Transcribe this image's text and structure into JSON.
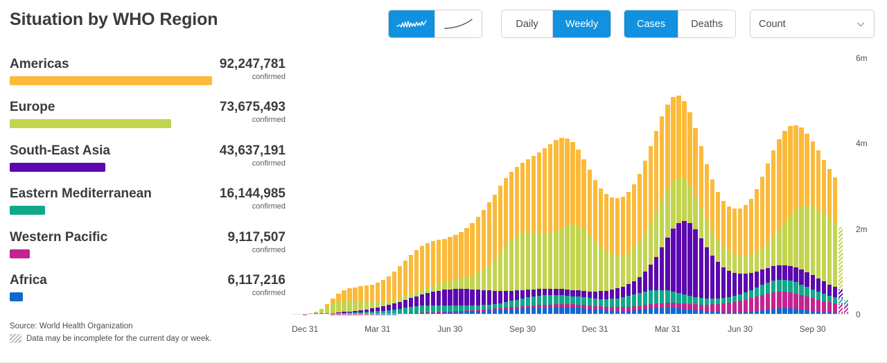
{
  "header": {
    "title": "Situation by WHO Region",
    "chart_type_toggle": {
      "options": [
        {
          "id": "daily-bars",
          "icon": "wavy-line-icon",
          "selected": true
        },
        {
          "id": "cumulative",
          "icon": "rising-curve-icon",
          "selected": false
        }
      ]
    },
    "interval_toggle": {
      "options": [
        {
          "label": "Daily",
          "selected": false
        },
        {
          "label": "Weekly",
          "selected": true
        }
      ]
    },
    "metric_toggle": {
      "options": [
        {
          "label": "Cases",
          "selected": true
        },
        {
          "label": "Deaths",
          "selected": false
        }
      ]
    },
    "measure_dropdown": {
      "value": "Count",
      "icon": "chevron-down-icon"
    }
  },
  "legend": {
    "confirmed_label": "confirmed",
    "regions": [
      {
        "name": "Americas",
        "count": "92,247,781",
        "value": 92247781,
        "color": "#FCBA3A",
        "bar_width_pct": 100.0
      },
      {
        "name": "Europe",
        "count": "73,675,493",
        "value": 73675493,
        "color": "#C3D44F",
        "bar_width_pct": 79.9
      },
      {
        "name": "South-East Asia",
        "count": "43,637,191",
        "value": 43637191,
        "color": "#5B08B0",
        "bar_width_pct": 47.3
      },
      {
        "name": "Eastern Mediterranean",
        "count": "16,144,985",
        "value": 16144985,
        "color": "#0FA98A",
        "bar_width_pct": 17.5
      },
      {
        "name": "Western Pacific",
        "count": "9,117,507",
        "value": 9117507,
        "color": "#C4248F",
        "bar_width_pct": 9.9
      },
      {
        "name": "Africa",
        "count": "6,117,216",
        "value": 6117216,
        "color": "#1069D0",
        "bar_width_pct": 6.6
      }
    ]
  },
  "footer": {
    "source": "Source:  World Health Organization",
    "note": "Data may be incomplete for the current day or week.",
    "note_icon": "hatched-swatch-icon"
  },
  "chart_data": {
    "type": "bar",
    "stacked": true,
    "title": "Situation by WHO Region",
    "xlabel": "",
    "ylabel": "",
    "ylim": [
      0,
      6000000
    ],
    "yticks": [
      0,
      2000000,
      4000000,
      6000000
    ],
    "ytick_labels": [
      "0",
      "2m",
      "4m",
      "6m"
    ],
    "grid": false,
    "legend_position": "left-panel",
    "xtick_labels": [
      "Dec 31",
      "Mar 31",
      "Jun 30",
      "Sep 30",
      "Dec 31",
      "Mar 31",
      "Jun 30",
      "Sep 30"
    ],
    "xtick_indices": [
      2,
      15,
      28,
      41,
      54,
      67,
      80,
      93
    ],
    "series": [
      {
        "name": "Africa",
        "color": "#1069D0",
        "values": [
          0,
          0,
          0,
          0,
          0,
          0,
          0,
          0,
          0,
          0,
          0,
          0,
          200,
          500,
          900,
          1500,
          2500,
          4000,
          6500,
          9000,
          12000,
          16000,
          21000,
          26000,
          30000,
          34000,
          38000,
          42000,
          47000,
          52000,
          58000,
          64000,
          70000,
          76000,
          84000,
          92000,
          100000,
          108000,
          116000,
          124000,
          132000,
          140000,
          148000,
          156000,
          162000,
          168000,
          172000,
          176000,
          178000,
          176000,
          170000,
          160000,
          148000,
          136000,
          124000,
          112000,
          100000,
          92000,
          86000,
          84000,
          88000,
          96000,
          108000,
          124000,
          140000,
          152000,
          160000,
          164000,
          160000,
          150000,
          136000,
          120000,
          104000,
          90000,
          78000,
          68000,
          60000,
          54000,
          50000,
          48000,
          48000,
          52000,
          60000,
          74000,
          92000,
          112000,
          130000,
          142000,
          146000,
          142000,
          130000,
          114000,
          96000,
          80000,
          66000,
          56000,
          48000,
          42000,
          38000,
          34000
        ]
      },
      {
        "name": "Western Pacific",
        "color": "#C4248F",
        "values": [
          200,
          600,
          3000,
          12000,
          22000,
          18000,
          12000,
          8000,
          6000,
          5000,
          4500,
          4500,
          5000,
          5500,
          6000,
          6500,
          7000,
          7500,
          8000,
          9000,
          10000,
          12000,
          14000,
          16000,
          18000,
          20000,
          22000,
          24000,
          26000,
          28000,
          30000,
          32000,
          34000,
          36000,
          38000,
          40000,
          42000,
          44000,
          46000,
          48000,
          50000,
          52000,
          54000,
          56000,
          58000,
          60000,
          62000,
          64000,
          66000,
          68000,
          70000,
          72000,
          74000,
          76000,
          78000,
          80000,
          82000,
          84000,
          86000,
          88000,
          90000,
          92000,
          94000,
          96000,
          98000,
          100000,
          104000,
          108000,
          112000,
          116000,
          120000,
          126000,
          134000,
          144000,
          156000,
          170000,
          186000,
          204000,
          224000,
          246000,
          270000,
          296000,
          322000,
          346000,
          366000,
          380000,
          388000,
          390000,
          386000,
          376000,
          362000,
          344000,
          324000,
          302000,
          280000,
          258000,
          238000,
          220000,
          204000,
          190000
        ]
      },
      {
        "name": "Eastern Mediterranean",
        "color": "#0FA98A",
        "values": [
          0,
          0,
          200,
          1200,
          3500,
          8000,
          14000,
          20000,
          26000,
          32000,
          38000,
          44000,
          50000,
          56000,
          62000,
          70000,
          80000,
          92000,
          106000,
          120000,
          134000,
          146000,
          156000,
          162000,
          164000,
          162000,
          156000,
          148000,
          138000,
          128000,
          118000,
          110000,
          104000,
          100000,
          98000,
          100000,
          106000,
          116000,
          130000,
          146000,
          164000,
          182000,
          198000,
          210000,
          218000,
          222000,
          222000,
          218000,
          210000,
          200000,
          190000,
          182000,
          176000,
          172000,
          170000,
          172000,
          178000,
          190000,
          208000,
          230000,
          254000,
          278000,
          300000,
          316000,
          324000,
          322000,
          310000,
          290000,
          266000,
          240000,
          214000,
          190000,
          170000,
          154000,
          142000,
          134000,
          130000,
          130000,
          134000,
          142000,
          154000,
          170000,
          190000,
          212000,
          234000,
          254000,
          270000,
          280000,
          282000,
          276000,
          264000,
          248000,
          228000,
          208000,
          188000,
          170000,
          154000,
          140000,
          128000,
          118000
        ]
      },
      {
        "name": "South-East Asia",
        "color": "#5B08B0",
        "values": [
          0,
          0,
          500,
          2000,
          4000,
          6000,
          9000,
          13000,
          18000,
          24000,
          31000,
          39000,
          48000,
          58000,
          70000,
          84000,
          100000,
          118000,
          138000,
          160000,
          184000,
          210000,
          238000,
          266000,
          294000,
          320000,
          344000,
          364000,
          380000,
          390000,
          394000,
          392000,
          384000,
          370000,
          352000,
          330000,
          306000,
          282000,
          258000,
          236000,
          216000,
          198000,
          182000,
          170000,
          160000,
          152000,
          146000,
          142000,
          140000,
          140000,
          142000,
          146000,
          152000,
          160000,
          170000,
          182000,
          196000,
          212000,
          230000,
          252000,
          280000,
          320000,
          380000,
          470000,
          600000,
          780000,
          1000000,
          1240000,
          1470000,
          1640000,
          1720000,
          1700000,
          1580000,
          1400000,
          1200000,
          1010000,
          850000,
          720000,
          620000,
          540000,
          480000,
          434000,
          400000,
          376000,
          358000,
          346000,
          340000,
          338000,
          340000,
          344000,
          348000,
          348000,
          342000,
          330000,
          312000,
          290000,
          266000,
          242000,
          220000
        ]
      },
      {
        "name": "Europe",
        "color": "#C3D44F",
        "values": [
          100,
          400,
          2000,
          9000,
          30000,
          78000,
          150000,
          220000,
          260000,
          270000,
          258000,
          234000,
          206000,
          180000,
          156000,
          136000,
          120000,
          108000,
          100000,
          96000,
          96000,
          100000,
          108000,
          120000,
          134000,
          150000,
          168000,
          188000,
          210000,
          234000,
          262000,
          296000,
          340000,
          400000,
          480000,
          590000,
          730000,
          890000,
          1050000,
          1190000,
          1290000,
          1340000,
          1350000,
          1330000,
          1300000,
          1280000,
          1290000,
          1340000,
          1420000,
          1500000,
          1540000,
          1520000,
          1440000,
          1320000,
          1180000,
          1040000,
          920000,
          830000,
          770000,
          740000,
          740000,
          770000,
          830000,
          910000,
          1000000,
          1080000,
          1130000,
          1140000,
          1110000,
          1050000,
          970000,
          880000,
          790000,
          710000,
          640000,
          580000,
          530000,
          490000,
          460000,
          440000,
          430000,
          430000,
          440000,
          470000,
          520000,
          600000,
          710000,
          850000,
          1010000,
          1180000,
          1340000,
          1470000,
          1560000,
          1610000,
          1620000,
          1600000,
          1560000,
          1510000,
          1460000
        ]
      },
      {
        "name": "Americas",
        "color": "#FCBA3A",
        "values": [
          0,
          0,
          200,
          1500,
          8000,
          25000,
          60000,
          110000,
          170000,
          230000,
          280000,
          320000,
          350000,
          380000,
          410000,
          450000,
          500000,
          570000,
          650000,
          740000,
          830000,
          910000,
          970000,
          1010000,
          1030000,
          1030000,
          1020000,
          1010000,
          1010000,
          1030000,
          1070000,
          1130000,
          1210000,
          1300000,
          1390000,
          1470000,
          1530000,
          1570000,
          1590000,
          1600000,
          1610000,
          1640000,
          1700000,
          1790000,
          1900000,
          2010000,
          2100000,
          2140000,
          2120000,
          2040000,
          1920000,
          1780000,
          1640000,
          1520000,
          1430000,
          1370000,
          1340000,
          1330000,
          1340000,
          1370000,
          1420000,
          1490000,
          1580000,
          1680000,
          1780000,
          1870000,
          1940000,
          1980000,
          1980000,
          1930000,
          1840000,
          1720000,
          1580000,
          1440000,
          1310000,
          1200000,
          1120000,
          1070000,
          1050000,
          1060000,
          1100000,
          1180000,
          1300000,
          1460000,
          1650000,
          1840000,
          2000000,
          2100000,
          2130000,
          2090000,
          1990000,
          1850000,
          1690000,
          1530000,
          1380000,
          1250000,
          1140000,
          1050000
        ]
      }
    ],
    "incomplete_bars": [
      98,
      99
    ]
  }
}
